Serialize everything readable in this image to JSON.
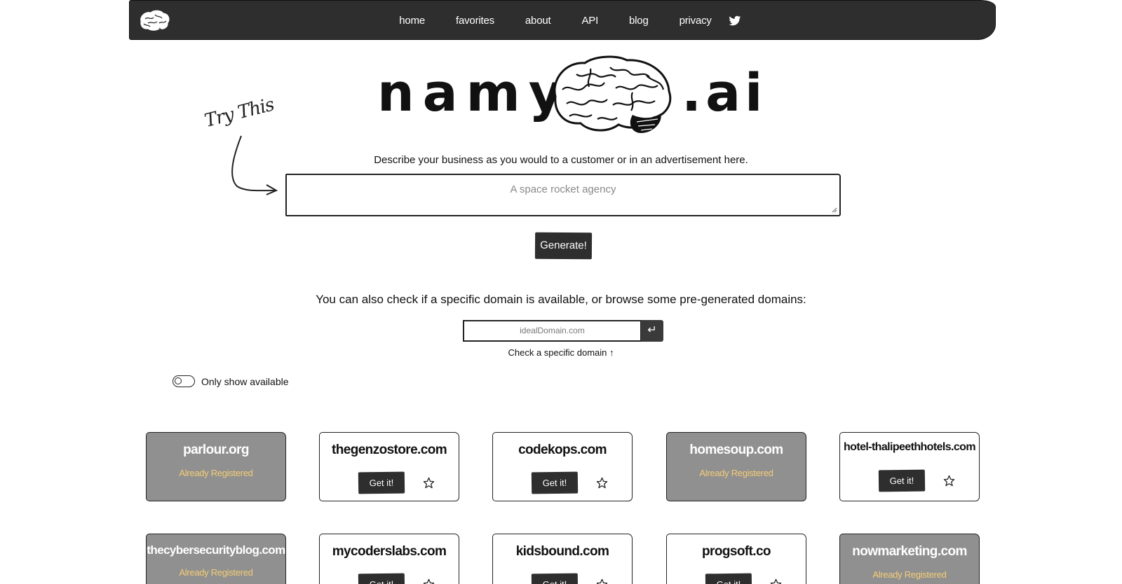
{
  "nav": {
    "logo_icon": "brain-icon",
    "links": [
      "home",
      "favorites",
      "about",
      "API",
      "blog",
      "privacy"
    ],
    "social_icon": "twitter-icon"
  },
  "hero": {
    "logo_left": "namy",
    "logo_right": ".ai",
    "logo_icon": "brain-icon",
    "try_this": "Try This"
  },
  "generator": {
    "description": "Describe your business as you would to a customer or in an advertisement here.",
    "placeholder": "A space rocket agency",
    "button_label": "Generate!"
  },
  "domain_check": {
    "prompt": "You can also check if a specific domain is available, or browse some pre-generated domains:",
    "placeholder": "idealDomain.com",
    "submit_icon": "enter-icon",
    "submit_glyph": "↵",
    "caption": "Check a specific domain ↑"
  },
  "filter": {
    "toggle_label": "Only show available",
    "toggle_on": false
  },
  "cards": [
    {
      "name": "parlour.org",
      "registered": true,
      "status": "Already Registered"
    },
    {
      "name": "thegenzostore.com",
      "registered": false,
      "action": "Get it!"
    },
    {
      "name": "codekops.com",
      "registered": false,
      "action": "Get it!"
    },
    {
      "name": "homesoup.com",
      "registered": true,
      "status": "Already Registered"
    },
    {
      "name": "hotel-thalipeethhotels.com",
      "registered": false,
      "action": "Get it!"
    },
    {
      "name": "thecybersecurityblog.com",
      "registered": true,
      "status": "Already Registered"
    },
    {
      "name": "mycoderslabs.com",
      "registered": false,
      "action": "Get it!"
    },
    {
      "name": "kidsbound.com",
      "registered": false,
      "action": "Get it!"
    },
    {
      "name": "progsoft.co",
      "registered": false,
      "action": "Get it!"
    },
    {
      "name": "nowmarketing.com",
      "registered": true,
      "status": "Already Registered"
    }
  ],
  "colors": {
    "nav_bg": "#2e2e2e",
    "registered_card_bg": "#909090",
    "registered_text": "#f5cd75",
    "button_bg": "#2e2e2e"
  }
}
